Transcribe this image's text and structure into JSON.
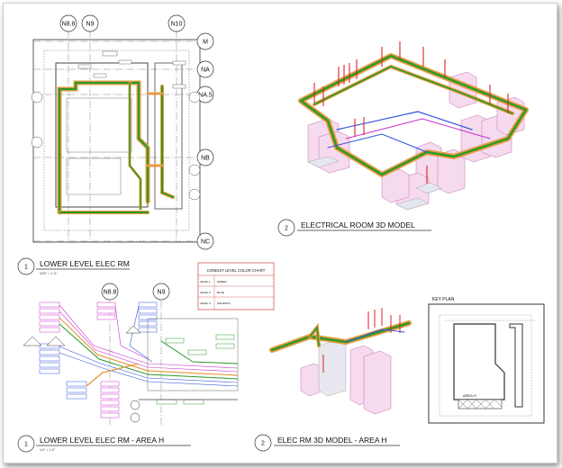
{
  "grid_labels": {
    "top": [
      "N8.8",
      "N9",
      "N10"
    ],
    "right": [
      "M",
      "NA",
      "NA.5",
      "NB",
      "NC"
    ],
    "area_top": [
      "N8.8",
      "N9"
    ]
  },
  "views": {
    "plan_lower": {
      "num": "1",
      "title": "LOWER LEVEL ELEC RM",
      "scale": "3/32\" = 1'-0\""
    },
    "model_room": {
      "num": "2",
      "title": "ELECTRICAL ROOM 3D MODEL"
    },
    "plan_area_h": {
      "num": "1",
      "title": "LOWER LEVEL ELEC RM - AREA H",
      "scale": "1/4\" = 1'-0\""
    },
    "model_area_h": {
      "num": "2",
      "title": "ELEC RM 3D MODEL - AREA H"
    }
  },
  "color_chart": {
    "title": "CONDUIT LEVEL COLOR CHART",
    "rows": [
      {
        "level": "LEVEL 1",
        "color_name": "GREEN",
        "hex": "#22aa22"
      },
      {
        "level": "LEVEL 2",
        "color_name": "BLUE",
        "hex": "#2244dd"
      },
      {
        "level": "LEVEL 3",
        "color_name": "MAGENTA",
        "hex": "#cc22cc"
      }
    ]
  },
  "key_plan": {
    "title": "KEY PLAN",
    "area_label": "AREA H"
  },
  "colors": {
    "green": "#2a9a2a",
    "orange": "#e89a40",
    "magenta": "#cc33cc",
    "blue": "#3355dd",
    "red": "#dd2222",
    "pink": "#e8a0d8"
  }
}
